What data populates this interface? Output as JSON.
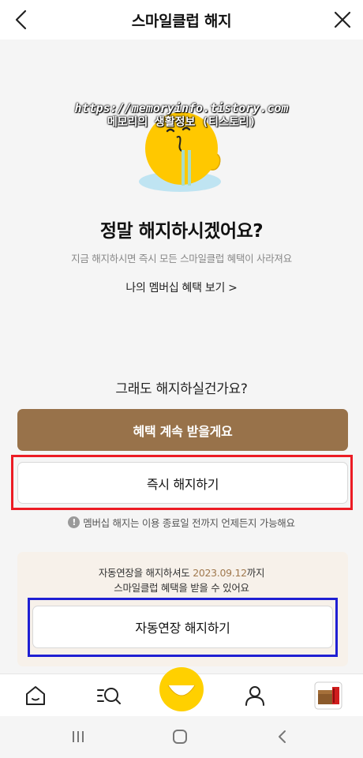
{
  "header": {
    "title": "스마일클럽 해지",
    "back_icon": "chevron-left-icon",
    "close_icon": "close-icon"
  },
  "watermark": {
    "line1": "https://memoryinfo.tistory.com",
    "line2": "메모리의 생활정보 (티스토리)"
  },
  "main": {
    "question": "정말 해지하시겠어요?",
    "subtext": "지금 해지하시면 즉시 모든 스마일클럽 혜택이 사라져요",
    "benefits_link": "나의 멤버십 혜택 보기 >",
    "confirm_question": "그래도 해지하실건가요?",
    "keep_button": "혜택 계속 받을게요",
    "cancel_button": "즉시 해지하기",
    "note": "멤버십 해지는 이용 종료일 전까지 언제든지 가능해요"
  },
  "auto_renew": {
    "text_before": "자동연장을 해지하셔도 ",
    "date": "2023.09.12",
    "text_after": "까지",
    "line2": "스마일클럽 혜택을 받을 수 있어요",
    "button": "자동연장 해지하기"
  },
  "colors": {
    "accent_brown": "#98724a",
    "date_color": "#a0794e",
    "highlight_red": "#ec1c24",
    "highlight_blue": "#1f1fd3",
    "mascot_yellow": "#ffc800"
  },
  "tabbar": {
    "items": [
      "home-icon",
      "list-search-icon",
      "smile-icon",
      "profile-icon",
      "gift-box-icon"
    ]
  },
  "system_nav": {
    "items": [
      "recents-icon",
      "home-icon",
      "back-icon"
    ]
  }
}
